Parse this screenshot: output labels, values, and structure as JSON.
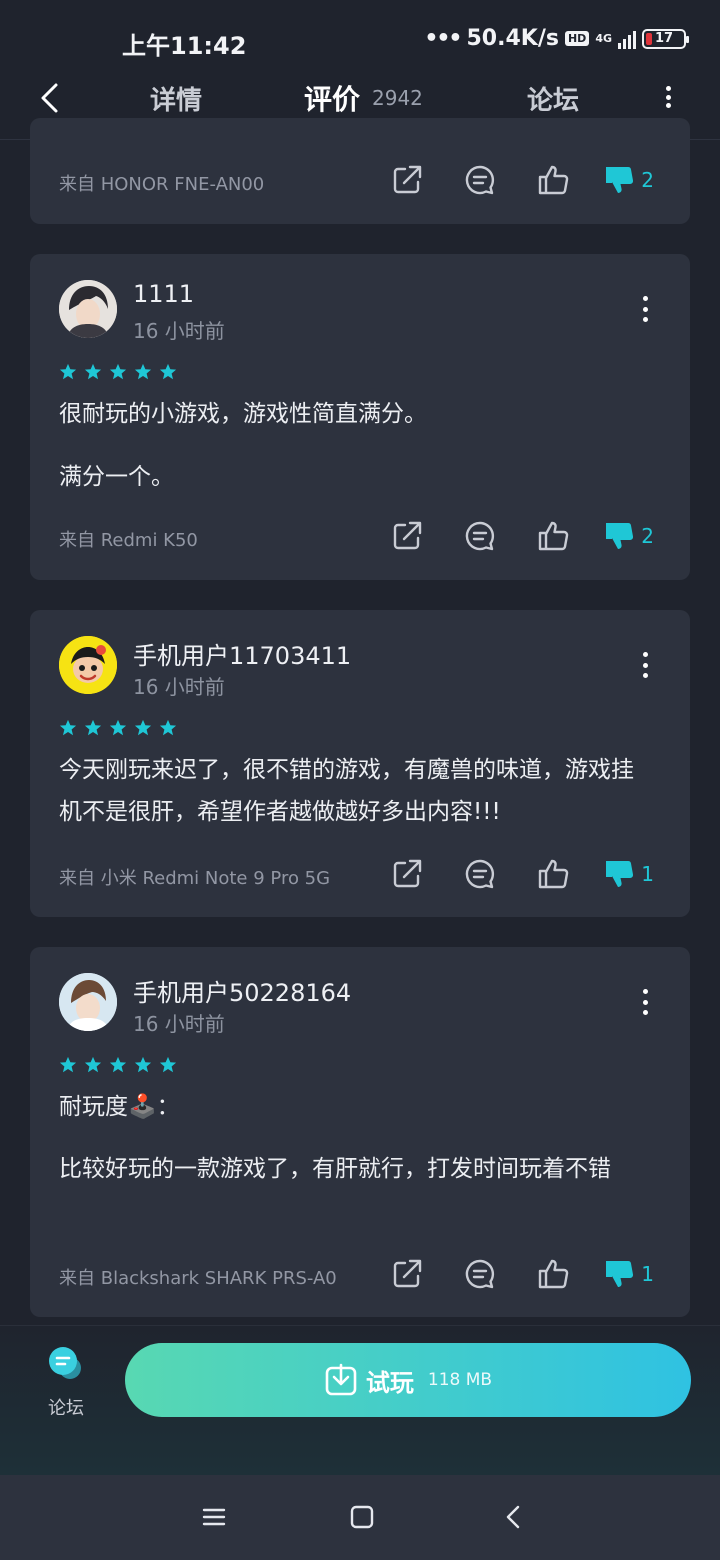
{
  "status_bar": {
    "time": "上午11:42",
    "network_speed": "50.4K/s",
    "hd_badge": "HD",
    "net_type": "4G",
    "battery_level": "17"
  },
  "nav": {
    "tabs": [
      {
        "label": "详情"
      },
      {
        "label": "评价",
        "count": "2942"
      },
      {
        "label": "论坛"
      }
    ],
    "active_tab": "评价"
  },
  "reviews": [
    {
      "device": "来自 HONOR FNE-AN00",
      "dislike_count": "2",
      "partial": true
    },
    {
      "username": "1111",
      "time": "16 小时前",
      "rating": 5,
      "paragraphs": [
        "很耐玩的小游戏，游戏性简直满分。",
        "满分一个。"
      ],
      "device": "来自 Redmi K50",
      "dislike_count": "2"
    },
    {
      "username": "手机用户11703411",
      "time": "16 小时前",
      "rating": 5,
      "paragraphs": [
        "今天刚玩来迟了，很不错的游戏，有魔兽的味道，游戏挂机不是很肝，希望作者越做越好多出内容!!!"
      ],
      "device": "来自 小米 Redmi Note 9 Pro 5G",
      "dislike_count": "1"
    },
    {
      "username": "手机用户50228164",
      "time": "16 小时前",
      "rating": 5,
      "paragraphs": [
        "耐玩度🕹️：",
        "比较好玩的一款游戏了，有肝就行，打发时间玩着不错"
      ],
      "device": "来自 Blackshark SHARK PRS-A0",
      "dislike_count": "1"
    }
  ],
  "bottom_bar": {
    "forum_label": "论坛",
    "play_label": "试玩",
    "play_size": "118 MB"
  },
  "colors": {
    "accent": "#1fc7d6",
    "card_bg": "#2d323e",
    "page_bg": "#1f232d",
    "button_gradient_start": "#58d8b2",
    "button_gradient_end": "#2fc2e2"
  }
}
